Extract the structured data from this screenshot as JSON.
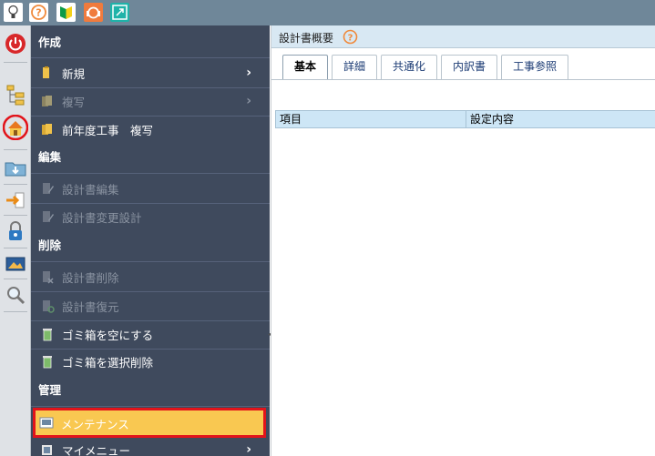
{
  "toolbar": {
    "icons": [
      "lightbulb-icon",
      "help-icon",
      "beginner-icon",
      "support-icon",
      "expand-icon"
    ]
  },
  "sidebar": {
    "icons": [
      "power-icon",
      "tree-icon",
      "home-icon",
      "folder-download-icon",
      "export-icon",
      "lock-icon",
      "image-icon",
      "search-icon"
    ]
  },
  "menu": {
    "sections": {
      "create": "作成",
      "edit": "編集",
      "delete": "削除",
      "manage": "管理"
    },
    "items": {
      "new": "新規",
      "copy": "複写",
      "prev_year_copy": "前年度工事　複写",
      "doc_edit": "設計書編集",
      "doc_change": "設計書変更設計",
      "doc_delete": "設計書削除",
      "doc_restore": "設計書復元",
      "empty_trash": "ゴミ箱を空にする",
      "trash_select_delete": "ゴミ箱を選択削除",
      "maintenance": "メンテナンス",
      "my_menu": "マイメニュー"
    },
    "chevron": "›"
  },
  "pane": {
    "title": "設計書概要",
    "tabs": [
      "基本",
      "詳細",
      "共通化",
      "内訳書",
      "工事参照"
    ],
    "columns": [
      "項目",
      "設定内容"
    ]
  },
  "colors": {
    "menu_bg": "#3f4a5d",
    "highlight_bg": "#f9c851",
    "highlight_border": "#e2141b",
    "header_bg": "#d8e8f3"
  }
}
